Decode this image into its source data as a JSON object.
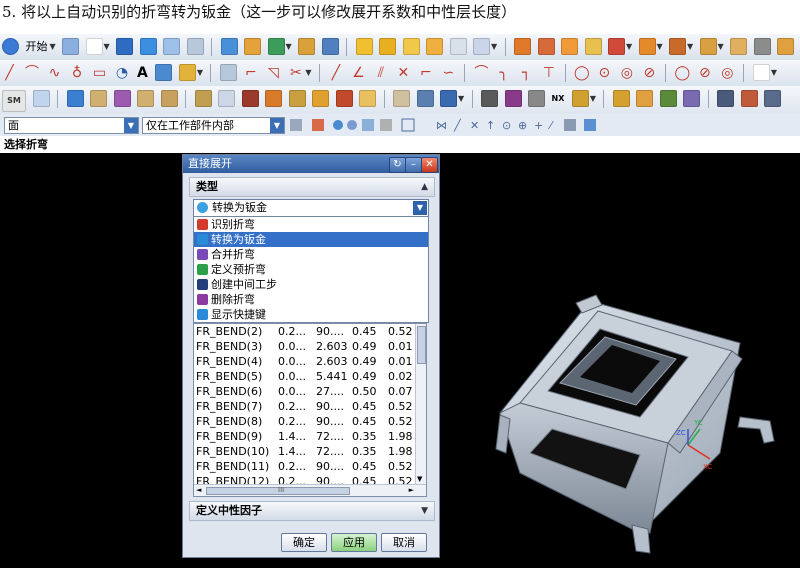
{
  "caption": "5. 将以上自动识别的折弯转为钣金（这一步可以修改展开系数和中性层长度）",
  "toolbar": {
    "start_label": "开始",
    "text_tool_label": "A",
    "sm_label": "SM",
    "nx_label": "NX"
  },
  "selection_bar": {
    "filter_value": "面",
    "scope_value": "仅在工作部件内部"
  },
  "status_prompt": "选择折弯",
  "dialog": {
    "title": "直接展开",
    "type_section": "类型",
    "type_selected": "转换为钣金",
    "dropdown_options": [
      {
        "label": "识别折弯",
        "icon": "identify-bend-icon",
        "color": "#d33a2c"
      },
      {
        "label": "转换为钣金",
        "icon": "convert-sheetmetal-icon",
        "color": "#2a8ad8"
      },
      {
        "label": "合并折弯",
        "icon": "merge-bend-icon",
        "color": "#7a4ab8"
      },
      {
        "label": "定义预折弯",
        "icon": "pre-bend-icon",
        "color": "#2d9e4a"
      },
      {
        "label": "创建中间工步",
        "icon": "intermediate-step-icon",
        "color": "#243e7a"
      },
      {
        "label": "删除折弯",
        "icon": "delete-bend-icon",
        "color": "#8a3aa0"
      },
      {
        "label": "显示快捷键",
        "icon": "shortcut-icon",
        "color": "#2a8ad8"
      }
    ],
    "bend_rows": [
      [
        "FR_BEND(2)",
        "0.2...",
        "90....",
        "0.45",
        "0.52"
      ],
      [
        "FR_BEND(3)",
        "0.0...",
        "2.603",
        "0.49",
        "0.01"
      ],
      [
        "FR_BEND(4)",
        "0.0...",
        "2.603",
        "0.49",
        "0.01"
      ],
      [
        "FR_BEND(5)",
        "0.0...",
        "5.441",
        "0.49",
        "0.02"
      ],
      [
        "FR_BEND(6)",
        "0.0...",
        "27....",
        "0.50",
        "0.07"
      ],
      [
        "FR_BEND(7)",
        "0.2...",
        "90....",
        "0.45",
        "0.52"
      ],
      [
        "FR_BEND(8)",
        "0.2...",
        "90....",
        "0.45",
        "0.52"
      ],
      [
        "FR_BEND(9)",
        "1.4...",
        "72....",
        "0.35",
        "1.98"
      ],
      [
        "FR_BEND(10)",
        "1.4...",
        "72....",
        "0.35",
        "1.98"
      ],
      [
        "FR_BEND(11)",
        "0.2...",
        "90....",
        "0.45",
        "0.52"
      ],
      [
        "FR_BEND(12)",
        "0.2...",
        "90....",
        "0.45",
        "0.52"
      ]
    ],
    "hscroll_grip": "III",
    "neutral_section": "定义中性因子",
    "ok_label": "确定",
    "apply_label": "应用",
    "cancel_label": "取消",
    "title_buttons": {
      "reset": "↻",
      "minimize": "–",
      "close": "✕"
    }
  },
  "axes": {
    "x": "XC",
    "y": "YC",
    "z": "ZC"
  },
  "colors": {
    "accent_blue": "#3570c8",
    "title_bar": "#2f5d9e",
    "apply_green": "#8bd17f",
    "viewport": "#000000",
    "axis_x": "#e03020",
    "axis_y": "#20b040",
    "axis_z": "#3050e0"
  }
}
